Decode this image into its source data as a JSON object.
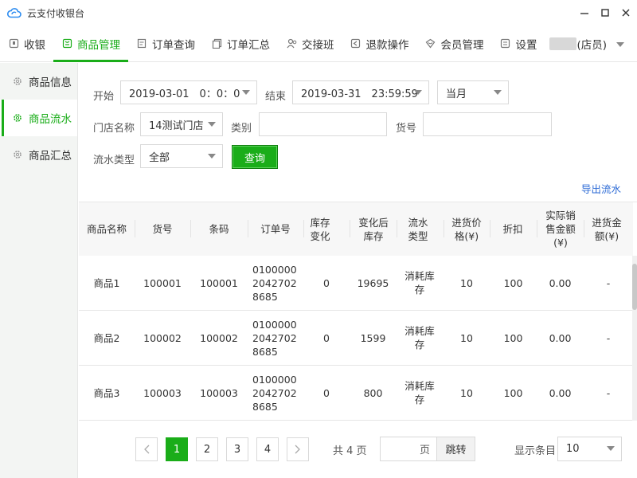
{
  "window": {
    "title": "云支付收银台",
    "logo_icon": "cloud-icon",
    "controls": [
      "minimize-icon",
      "maximize-icon",
      "close-icon"
    ]
  },
  "nav": {
    "items": [
      {
        "label": "收银",
        "icon": "cashier-icon"
      },
      {
        "label": "商品管理",
        "icon": "goods-icon",
        "active": true
      },
      {
        "label": "订单查询",
        "icon": "order-search-icon"
      },
      {
        "label": "订单汇总",
        "icon": "order-summary-icon"
      },
      {
        "label": "交接班",
        "icon": "shift-icon"
      },
      {
        "label": "退款操作",
        "icon": "refund-icon"
      },
      {
        "label": "会员管理",
        "icon": "member-icon"
      },
      {
        "label": "设置",
        "icon": "settings-icon"
      }
    ],
    "user_role": "(店员)"
  },
  "sidebar": {
    "items": [
      {
        "label": "商品信息"
      },
      {
        "label": "商品流水",
        "active": true
      },
      {
        "label": "商品汇总"
      }
    ]
  },
  "filters": {
    "start_label": "开始",
    "start_value": "2019-03-01　0：0：0",
    "end_label": "结束",
    "end_value": "2019-03-31　23:59:59",
    "period_value": "当月",
    "store_label": "门店名称",
    "store_value": "14测试门店",
    "category_label": "类别",
    "category_value": "",
    "sku_label": "货号",
    "sku_value": "",
    "flow_type_label": "流水类型",
    "flow_type_value": "全部",
    "query_button": "查询",
    "export_link": "导出流水"
  },
  "table": {
    "columns": [
      "商品名称",
      "货号",
      "条码",
      "订单号",
      "库存变化",
      "变化后库存",
      "流水类型",
      "进货价格(¥)",
      "折扣",
      "实际销售金额(¥)",
      "进货金额(¥)"
    ],
    "rows": [
      [
        "商品1",
        "100001",
        "100001",
        "010000020427028685",
        "0",
        "19695",
        "消耗库存",
        "10",
        "100",
        "0.00",
        "-"
      ],
      [
        "商品2",
        "100002",
        "100002",
        "010000020427028685",
        "0",
        "1599",
        "消耗库存",
        "10",
        "100",
        "0.00",
        "-"
      ],
      [
        "商品3",
        "100003",
        "100003",
        "010000020427028685",
        "0",
        "800",
        "消耗库存",
        "10",
        "100",
        "0.00",
        "-"
      ]
    ]
  },
  "pagination": {
    "pages": [
      "1",
      "2",
      "3",
      "4"
    ],
    "current": "1",
    "total_text": "共 4 页",
    "jump_unit": "页",
    "jump_button": "跳转",
    "page_size_label": "显示条目",
    "page_size_value": "10"
  },
  "colors": {
    "accent": "#1aad19",
    "link": "#2d6bd6"
  }
}
